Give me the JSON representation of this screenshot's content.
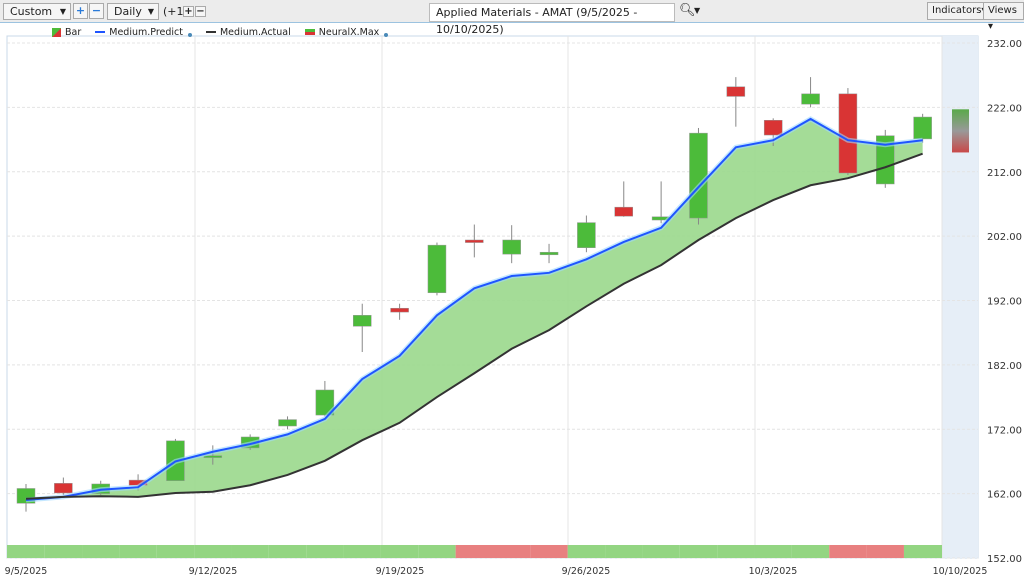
{
  "toolbar": {
    "range_select": "Custom",
    "interval_select": "Daily",
    "offset": "(+1)",
    "title": "Applied Materials - AMAT (9/5/2025 - 10/10/2025)",
    "indicators": "Indicators",
    "views": "Views",
    "plus": "+",
    "minus": "−"
  },
  "legend": {
    "bar": "Bar",
    "predict": "Medium.Predict",
    "actual": "Medium.Actual",
    "neural": "NeuralX.Max"
  },
  "colors": {
    "up": "#4cbb3a",
    "down": "#d93434",
    "predict": "#1f55ff",
    "actual": "#333333",
    "fill": "#9ad88c",
    "band_up": "#93d582",
    "band_down": "#e88080",
    "forecast_bg": "#e6eef7"
  },
  "chart_data": {
    "type": "candlestick",
    "ylim": [
      152,
      232
    ],
    "yticks": [
      "232.00",
      "222.00",
      "212.00",
      "202.00",
      "192.00",
      "182.00",
      "172.00",
      "162.00",
      "152.00"
    ],
    "xticks": [
      "9/5/2025",
      "9/12/2025",
      "9/19/2025",
      "9/26/2025",
      "10/3/2025",
      "10/10/2025"
    ],
    "dates": [
      "9/5",
      "9/8",
      "9/9",
      "9/10",
      "9/11",
      "9/12",
      "9/15",
      "9/16",
      "9/17",
      "9/18",
      "9/19",
      "9/22",
      "9/23",
      "9/24",
      "9/25",
      "9/26",
      "9/29",
      "9/30",
      "10/1",
      "10/2",
      "10/3",
      "10/6",
      "10/7",
      "10/8",
      "10/9"
    ],
    "ohlc": [
      [
        160.5,
        163.5,
        159.2,
        162.8
      ],
      [
        163.6,
        164.5,
        161.8,
        162.1
      ],
      [
        162,
        164,
        161.8,
        163.5
      ],
      [
        164.1,
        165,
        162.5,
        163.3
      ],
      [
        164,
        170.5,
        164,
        170.2
      ],
      [
        167.7,
        169.5,
        166.5,
        167.9
      ],
      [
        169.1,
        171.2,
        168.8,
        170.8
      ],
      [
        172.5,
        174,
        172,
        173.5
      ],
      [
        174.2,
        179.5,
        174,
        178.1
      ],
      [
        188,
        191.5,
        184,
        189.7
      ],
      [
        190.8,
        191.5,
        189,
        190.2
      ],
      [
        193.2,
        201,
        192.8,
        200.6
      ],
      [
        201.4,
        203.8,
        198.7,
        201.0
      ],
      [
        199.2,
        203.7,
        197.8,
        201.4
      ],
      [
        199.1,
        200.8,
        197.8,
        199.5
      ],
      [
        200.2,
        205.2,
        199.5,
        204.1
      ],
      [
        206.5,
        210.5,
        205,
        205.1
      ],
      [
        204.5,
        210.5,
        204,
        205
      ],
      [
        204.8,
        218.8,
        203.8,
        218
      ],
      [
        225.2,
        226.7,
        219,
        223.7
      ],
      [
        220,
        220.3,
        216,
        217.7
      ],
      [
        222.5,
        226.7,
        222,
        224.1
      ],
      [
        224.1,
        225,
        211.5,
        211.8
      ],
      [
        210.1,
        218.5,
        209.5,
        217.6
      ],
      [
        217.1,
        221,
        216.5,
        220.5
      ]
    ],
    "forecast": {
      "date": "10/10",
      "high": 221.7,
      "low": 215
    },
    "medium_predict": [
      161,
      161.5,
      162.6,
      163,
      167,
      168.5,
      169.7,
      171.2,
      173.6,
      179.8,
      183.4,
      189.7,
      193.9,
      195.8,
      196.3,
      198.4,
      201.1,
      203.3,
      209.6,
      215.8,
      216.9,
      220.2,
      216.9,
      216.2,
      216.9
    ],
    "medium_actual": [
      161.2,
      161.5,
      161.6,
      161.5,
      162.1,
      162.3,
      163.3,
      164.9,
      167.1,
      170.3,
      173,
      177,
      180.7,
      184.5,
      187.4,
      191.1,
      194.6,
      197.5,
      201.4,
      204.8,
      207.6,
      209.9,
      211,
      212.7,
      214.8
    ],
    "neuralx_max": [
      "up",
      "up",
      "up",
      "up",
      "up",
      "up",
      "up",
      "up",
      "up",
      "up",
      "up",
      "up",
      "down",
      "down",
      "down",
      "up",
      "up",
      "up",
      "up",
      "up",
      "up",
      "up",
      "down",
      "down",
      "up"
    ],
    "grid": true
  }
}
